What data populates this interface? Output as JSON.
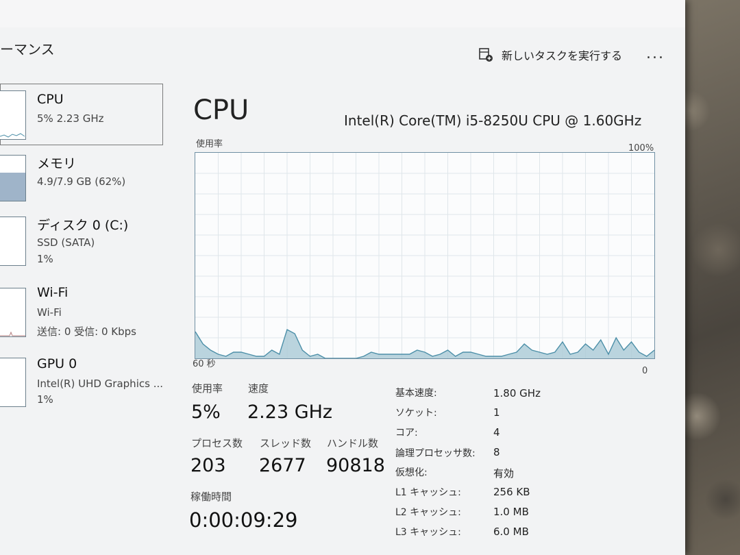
{
  "header": {
    "title": "ーマンス",
    "new_task_label": "新しいタスクを実行する",
    "more_label": "..."
  },
  "sidebar": {
    "items": [
      {
        "name": "CPU",
        "sub1": "5%  2.23 GHz",
        "sub2": "",
        "icon": "cpu-thumbnail"
      },
      {
        "name": "メモリ",
        "sub1": "4.9/7.9 GB (62%)",
        "sub2": "",
        "icon": "memory-thumbnail"
      },
      {
        "name": "ディスク 0 (C:)",
        "sub1": "SSD (SATA)",
        "sub2": "1%",
        "icon": "disk-thumbnail"
      },
      {
        "name": "Wi-Fi",
        "sub1": "Wi-Fi",
        "sub2": "送信: 0  受信: 0 Kbps",
        "icon": "wifi-thumbnail"
      },
      {
        "name": "GPU 0",
        "sub1": "Intel(R) UHD Graphics ...",
        "sub2": "1%",
        "icon": "gpu-thumbnail"
      }
    ]
  },
  "main": {
    "title": "CPU",
    "cpu_name": "Intel(R) Core(TM) i5-8250U CPU @ 1.60GHz",
    "graph_label": "使用率",
    "graph_max": "100%",
    "graph_time": "60 秒",
    "graph_min": "0",
    "stats": {
      "usage_label": "使用率",
      "usage_value": "5%",
      "speed_label": "速度",
      "speed_value": "2.23 GHz",
      "process_label": "プロセス数",
      "process_value": "203",
      "thread_label": "スレッド数",
      "thread_value": "2677",
      "handle_label": "ハンドル数",
      "handle_value": "90818",
      "uptime_label": "稼働時間",
      "uptime_value": "0:00:09:29"
    },
    "details": [
      {
        "label": "基本速度:",
        "value": "1.80 GHz"
      },
      {
        "label": "ソケット:",
        "value": "1"
      },
      {
        "label": "コア:",
        "value": "4"
      },
      {
        "label": "論理プロセッサ数:",
        "value": "8"
      },
      {
        "label": "仮想化:",
        "value": "有効"
      },
      {
        "label": "L1 キャッシュ:",
        "value": "256 KB"
      },
      {
        "label": "L2 キャッシュ:",
        "value": "1.0 MB"
      },
      {
        "label": "L3 キャッシュ:",
        "value": "6.0 MB"
      }
    ]
  },
  "chart_data": {
    "type": "area",
    "title": "",
    "xlabel": "",
    "ylabel": "使用率",
    "ylim": [
      0,
      100
    ],
    "xlim": [
      60,
      0
    ],
    "x": [
      60,
      59,
      58,
      57,
      56,
      55,
      54,
      53,
      52,
      51,
      50,
      49,
      48,
      47,
      46,
      45,
      44,
      43,
      42,
      41,
      40,
      39,
      38,
      37,
      36,
      35,
      34,
      33,
      32,
      31,
      30,
      29,
      28,
      27,
      26,
      25,
      24,
      23,
      22,
      21,
      20,
      19,
      18,
      17,
      16,
      15,
      14,
      13,
      12,
      11,
      10,
      9,
      8,
      7,
      6,
      5,
      4,
      3,
      2,
      1,
      0
    ],
    "series": [
      {
        "values": [
          13,
          7,
          4,
          2,
          1,
          3,
          3,
          2,
          1,
          1,
          4,
          2,
          14,
          12,
          4,
          1,
          2,
          0,
          0,
          0,
          0,
          0,
          1,
          3,
          2,
          2,
          2,
          2,
          2,
          4,
          3,
          1,
          2,
          4,
          1,
          3,
          3,
          2,
          1,
          1,
          1,
          2,
          3,
          7,
          4,
          3,
          2,
          3,
          8,
          2,
          3,
          7,
          4,
          9,
          2,
          10,
          4,
          8,
          3,
          1,
          4
        ]
      }
    ],
    "grid": true
  },
  "colors": {
    "graph_line": "#4c8fa8",
    "graph_fill": "#aac9d6",
    "graph_grid": "#dfe6ea",
    "graph_border": "#6f8fa3"
  }
}
